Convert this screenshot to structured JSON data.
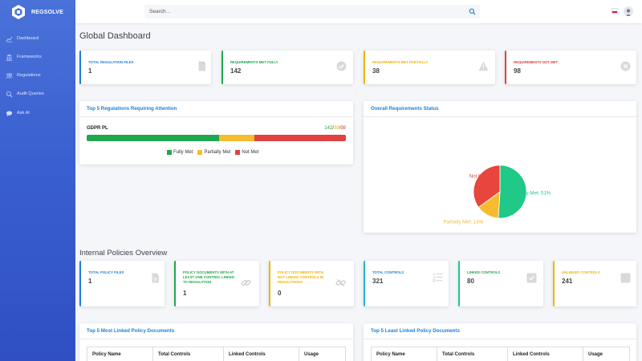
{
  "brand": {
    "name": "REGSOLVE"
  },
  "sidebar": {
    "items": [
      {
        "label": "Dashboard",
        "icon": "chart-line-icon"
      },
      {
        "label": "Frameworks",
        "icon": "building-columns-icon"
      },
      {
        "label": "Regulations",
        "icon": "users-icon"
      },
      {
        "label": "Audit Queries",
        "icon": "search-icon"
      },
      {
        "label": "Ask AI",
        "icon": "chat-bubble-icon"
      }
    ]
  },
  "search": {
    "placeholder": "Search..."
  },
  "page_title": "Global Dashboard",
  "stats": [
    {
      "label": "TOTAL REGULATION FILES",
      "value": "1",
      "color": "#1f7fd6",
      "icon": "file-icon"
    },
    {
      "label": "REQUIREMENTS MET FULLY",
      "value": "142",
      "color": "#20a74d",
      "icon": "check-circle-icon"
    },
    {
      "label": "REQUIREMENTS MET PARTIALLY",
      "value": "38",
      "color": "#f0b400",
      "icon": "warning-icon"
    },
    {
      "label": "REQUIREMENTS NOT MET",
      "value": "98",
      "color": "#e0423e",
      "icon": "x-circle-icon"
    }
  ],
  "attention_panel": {
    "title": "Top 5 Regulations Requiring Attention",
    "row_label": "GDPR PL",
    "fully": "142",
    "partially": "38",
    "not_met": "98",
    "sep": "/",
    "legend": [
      "Fully Met",
      "Partially Met",
      "Not Met"
    ]
  },
  "status_panel": {
    "title": "Overall Requirements Status"
  },
  "chart_data": {
    "type": "pie",
    "labels": [
      "Fully Met: 51%",
      "Partially Met: 14%",
      "Not Met: 35%"
    ],
    "categories": [
      "Fully Met",
      "Partially Met",
      "Not Met"
    ],
    "values": [
      51,
      14,
      35
    ],
    "colors": [
      "#20c987",
      "#f5bc2f",
      "#e8453c"
    ]
  },
  "section_title": "Internal Policies Overview",
  "policy_stats": [
    {
      "label": "TOTAL POLICY FILES",
      "value": "1",
      "color": "#1f7fd6",
      "icon": "file-icon"
    },
    {
      "label": "POLICY DOCUMENTS WITH AT LEAST ONE CONTROL LINKED TO REGULATION",
      "value": "1",
      "color": "#20a74d",
      "icon": "link-icon"
    },
    {
      "label": "POLICY DOCUMENTS WITH NOT LINKED CONTROLS IN REGULATIONS",
      "value": "0",
      "color": "#f0b400",
      "icon": "broken-link-icon"
    },
    {
      "label": "TOTAL CONTROLS",
      "value": "321",
      "color": "#1f7fd6",
      "icon": "list-check-icon"
    },
    {
      "label": "LINKED CONTROLS",
      "value": "80",
      "color": "#20a74d",
      "icon": "checked-box-icon"
    },
    {
      "label": "UNLINKED CONTROLS",
      "value": "241",
      "color": "#f0b400",
      "icon": "empty-box-icon"
    }
  ],
  "most_linked": {
    "title": "Top 5 Most Linked Policy Documents",
    "columns": [
      "Policy Name",
      "Total Controls",
      "Linked Controls",
      "Usage"
    ]
  },
  "least_linked": {
    "title": "Top 5 Least Linked Policy Documents",
    "columns": [
      "Policy Name",
      "Total Controls",
      "Linked Controls",
      "Usage"
    ]
  }
}
